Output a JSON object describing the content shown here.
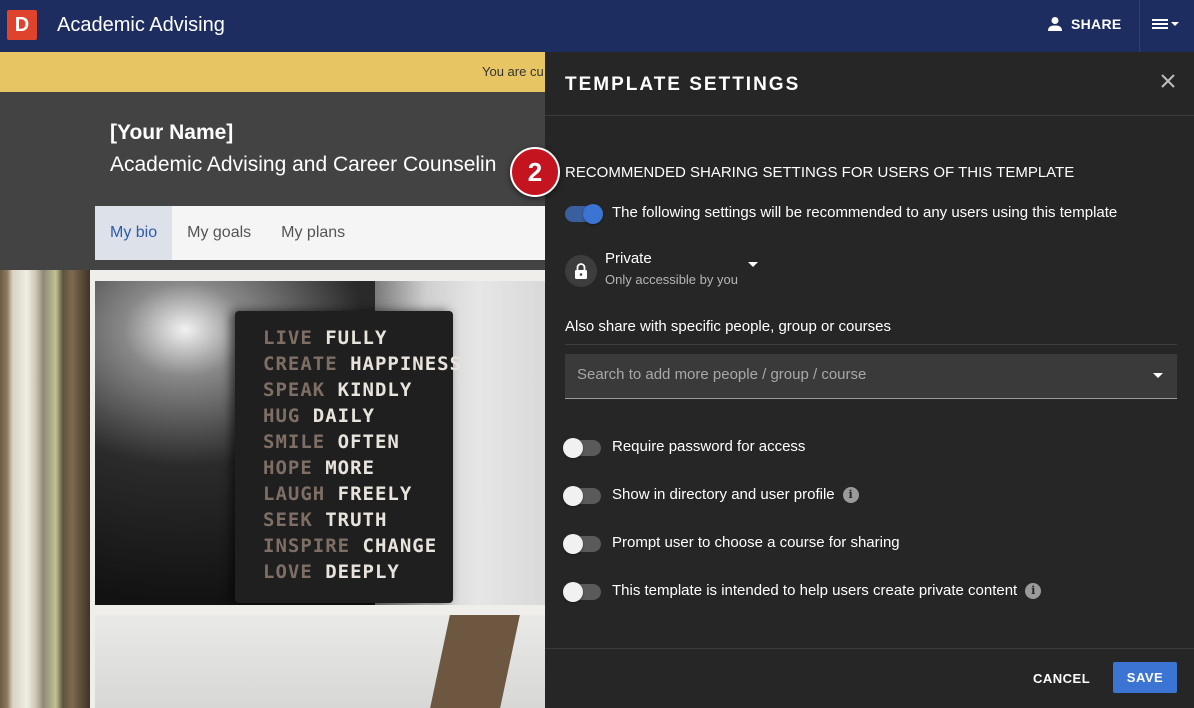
{
  "app": {
    "logo_letter": "D",
    "title": "Academic Advising"
  },
  "topbar": {
    "share_label": "SHARE",
    "user_icon": "person-icon",
    "menu_icon": "hamburger-menu-icon"
  },
  "notice": {
    "text": "You are cu"
  },
  "page": {
    "owner_name": "[Your Name]",
    "subtitle": "Academic Advising and Career Counselin",
    "tabs": [
      {
        "label": "My bio",
        "active": true
      },
      {
        "label": "My goals",
        "active": false
      },
      {
        "label": "My plans",
        "active": false
      }
    ]
  },
  "photo_text": [
    {
      "a": "LIVE",
      "b": "FULLY"
    },
    {
      "a": "CREATE",
      "b": "HAPPINESS"
    },
    {
      "a": "SPEAK",
      "b": "KINDLY"
    },
    {
      "a": "HUG",
      "b": "DAILY"
    },
    {
      "a": "SMILE",
      "b": "OFTEN"
    },
    {
      "a": "HOPE",
      "b": "MORE"
    },
    {
      "a": "LAUGH",
      "b": "FREELY"
    },
    {
      "a": "SEEK",
      "b": "TRUTH"
    },
    {
      "a": "INSPIRE",
      "b": "CHANGE"
    },
    {
      "a": "LOVE",
      "b": "DEEPLY"
    }
  ],
  "panel": {
    "title": "TEMPLATE SETTINGS",
    "step_number": "2",
    "section_heading": "RECOMMENDED SHARING SETTINGS FOR USERS OF THIS TEMPLATE",
    "recommend_toggle": {
      "label": "The following settings will be recommended to any users using this template",
      "on": true
    },
    "privacy": {
      "label": "Private",
      "description": "Only accessible by you"
    },
    "share_with_label": "Also share with specific people, group or courses",
    "search": {
      "placeholder": "Search to add more people / group / course",
      "value": ""
    },
    "options": [
      {
        "label": "Require password for access",
        "on": false,
        "info": false
      },
      {
        "label": "Show in directory and user profile",
        "on": false,
        "info": true
      },
      {
        "label": "Prompt user to choose a course for sharing",
        "on": false,
        "info": false
      },
      {
        "label": "This template is intended to help users create private content",
        "on": false,
        "info": true
      }
    ],
    "info_glyph": "i",
    "cancel_label": "CANCEL",
    "save_label": "SAVE"
  },
  "colors": {
    "topbar": "#1d2d5f",
    "accent": "#3c74d3",
    "step_badge": "#c4141f",
    "notice": "#e8c563",
    "logo": "#e0432c"
  }
}
